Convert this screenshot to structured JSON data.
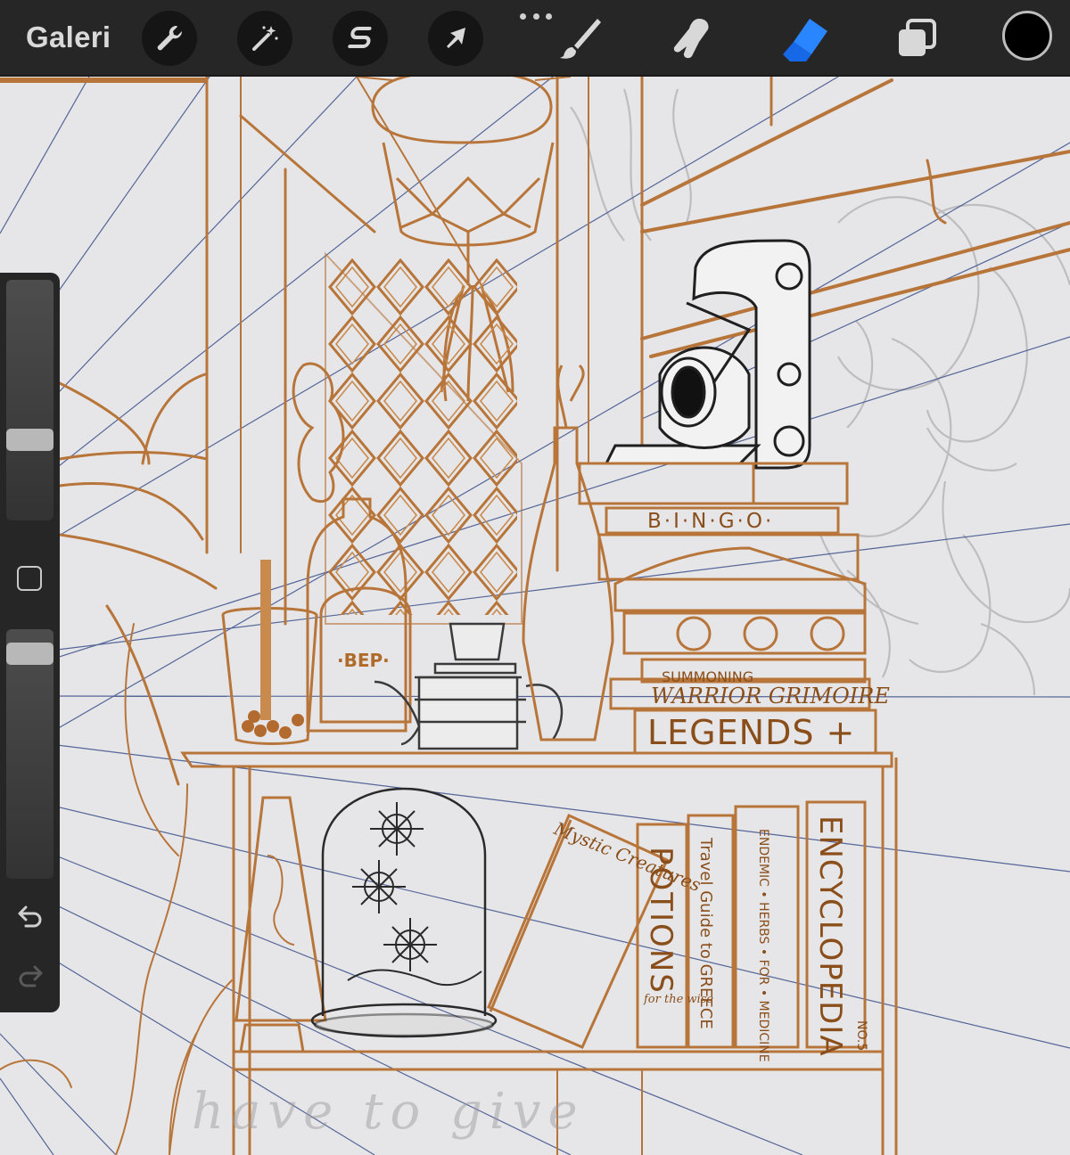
{
  "toolbar": {
    "gallery_label": "Galeri",
    "tools": [
      {
        "name": "actions",
        "icon": "wrench-icon"
      },
      {
        "name": "adjustments",
        "icon": "magic-wand-icon"
      },
      {
        "name": "selection",
        "icon": "selection-s-icon"
      },
      {
        "name": "transform",
        "icon": "arrow-cursor-icon"
      },
      {
        "name": "brush",
        "icon": "brush-icon"
      },
      {
        "name": "smudge",
        "icon": "smudge-finger-icon"
      },
      {
        "name": "eraser",
        "icon": "eraser-icon",
        "active": true
      },
      {
        "name": "layers",
        "icon": "layers-icon"
      }
    ],
    "active_color": "#000000",
    "accent_color": "#1e78ff"
  },
  "sidebar": {
    "brush_size_level": 0.32,
    "brush_opacity_level": 0.94
  },
  "artwork": {
    "book_titles": {
      "bingo": "B·I·N·G·O·",
      "summoning": "SUMMONING",
      "warrior": "WARRIOR GRIMOIRE",
      "legends": "LEGENDS +",
      "mystic": "Mystic Creatures",
      "potions": "POTIONS",
      "potions_sub": "for the wise",
      "travel": "Travel Guide to GREECE",
      "endemic": "ENDEMIC • HERBS • FOR • MEDICINE",
      "encyclopedia": "ENCYCLOPEDIA",
      "encyclopedia_sub": "NO.5"
    },
    "jar_label": "·BEP·",
    "background_handwriting": "have to give"
  }
}
